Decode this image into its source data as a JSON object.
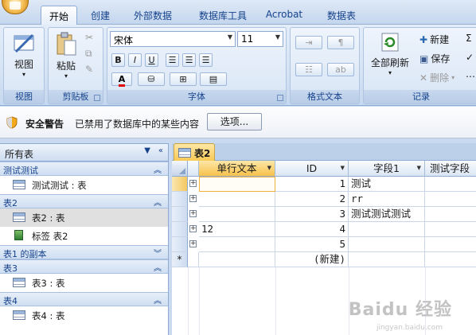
{
  "tabs": [
    "开始",
    "创建",
    "外部数据",
    "数据库工具",
    "Acrobat",
    "数据表"
  ],
  "ribbon": {
    "view": {
      "label": "视图",
      "group": "视图"
    },
    "clipboard": {
      "paste": "粘贴",
      "group": "剪贴板"
    },
    "font": {
      "name": "宋体",
      "size": "11",
      "bold": "B",
      "italic": "I",
      "underline": "U",
      "group": "字体"
    },
    "rich_text": {
      "group": "格式文本"
    },
    "records": {
      "refresh": "全部刷新",
      "new": "新建",
      "save": "保存",
      "delete": "删除",
      "group": "记录"
    }
  },
  "security": {
    "title": "安全警告",
    "message": "已禁用了数据库中的某些内容",
    "options_button": "选项..."
  },
  "nav": {
    "header": "所有表",
    "groups": [
      {
        "title": "测试测试",
        "items": [
          {
            "label": "测试测试 : 表"
          }
        ]
      },
      {
        "title": "表2",
        "items": [
          {
            "label": "表2 : 表"
          },
          {
            "label": "标签 表2"
          }
        ]
      },
      {
        "title": "表1 的副本",
        "items": []
      },
      {
        "title": "表3",
        "items": [
          {
            "label": "表3 : 表"
          }
        ]
      },
      {
        "title": "表4",
        "items": [
          {
            "label": "表4 : 表"
          }
        ]
      }
    ]
  },
  "document_tab": "表2",
  "datasheet": {
    "columns": [
      "单行文本",
      "ID",
      "字段1",
      "测试字段"
    ],
    "rows": [
      {
        "text": "",
        "id": "1",
        "f1": "测试"
      },
      {
        "text": "",
        "id": "2",
        "f1": "rr"
      },
      {
        "text": "",
        "id": "3",
        "f1": "测试测试测试"
      },
      {
        "text": "12",
        "id": "4",
        "f1": ""
      },
      {
        "text": "",
        "id": "5",
        "f1": ""
      }
    ],
    "new_row_marker": "*",
    "new_row_label": "(新建)"
  },
  "watermark": {
    "brand": "Baidu 经验",
    "url": "jingyan.baidu.com"
  },
  "colors": {
    "accent": "#15428b",
    "selected_header": "#f7c14b",
    "ribbon": "#d5e3f4"
  }
}
